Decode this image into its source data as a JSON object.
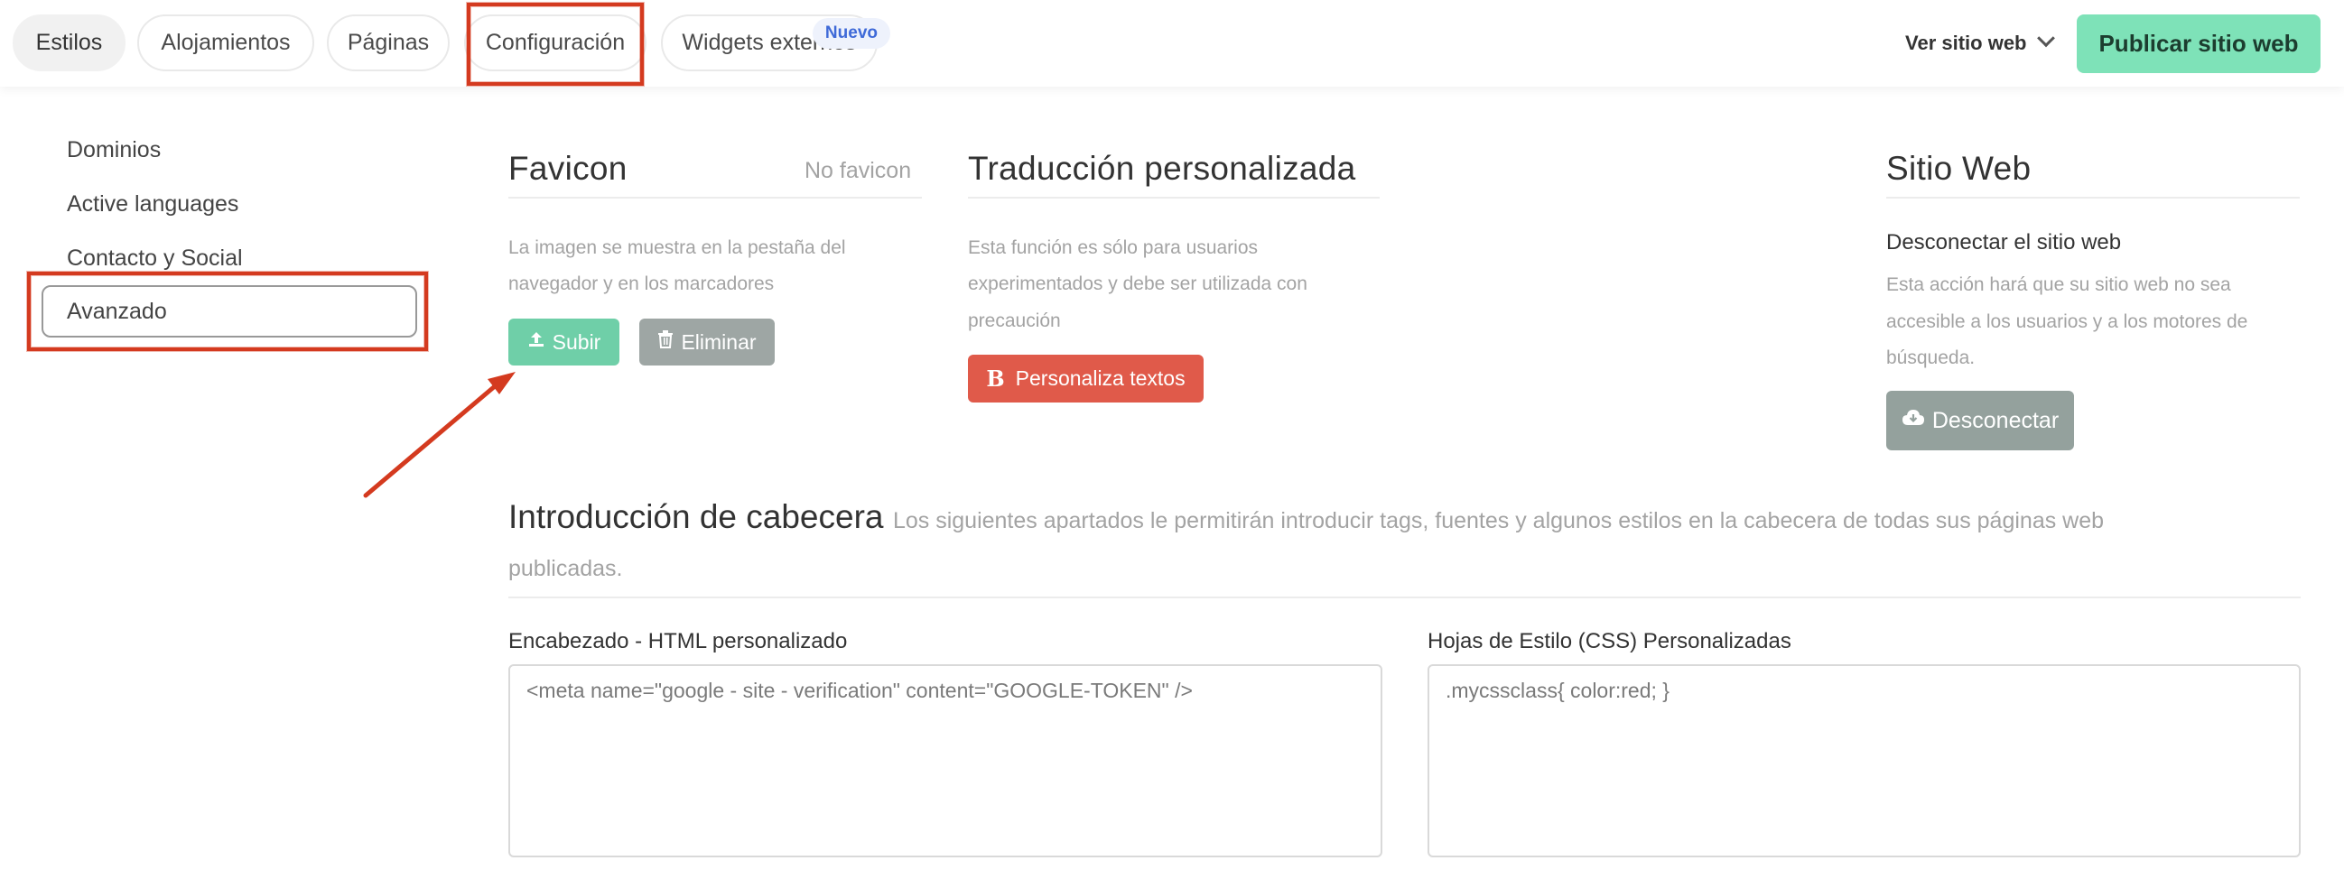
{
  "tabs": [
    {
      "label": "Estilos"
    },
    {
      "label": "Alojamientos"
    },
    {
      "label": "Páginas"
    },
    {
      "label": "Configuración"
    },
    {
      "label": "Widgets externos",
      "badge": "Nuevo"
    }
  ],
  "header": {
    "view_site": "Ver sitio web",
    "publish": "Publicar sitio web"
  },
  "sidebar": {
    "items": [
      {
        "label": "Dominios"
      },
      {
        "label": "Active languages"
      },
      {
        "label": "Contacto y Social"
      },
      {
        "label": "Avanzado"
      }
    ]
  },
  "favicon": {
    "title": "Favicon",
    "status": "No favicon",
    "description_line1": "La imagen se muestra en la pestaña del",
    "description_line2": "navegador y en los marcadores",
    "upload_label": "Subir",
    "delete_label": "Eliminar"
  },
  "translation": {
    "title": "Traducción personalizada",
    "description_line1": "Esta función es sólo para usuarios",
    "description_line2": "experimentados y debe ser utilizada con",
    "description_line3": "precaución",
    "button_label": "Personaliza textos",
    "button_icon": "B"
  },
  "website": {
    "title": "Sitio Web",
    "subtitle": "Desconectar el sitio web",
    "description_line1": "Esta acción hará que su sitio web no sea",
    "description_line2": "accesible a los usuarios y a los motores de",
    "description_line3": "búsqueda.",
    "button_label": "Desconectar"
  },
  "header_intro": {
    "title": "Introducción de cabecera",
    "description_part1": "Los siguientes apartados le permitirán introducir tags, fuentes y algunos estilos en la cabecera de todas sus páginas web",
    "description_part2": "publicadas."
  },
  "custom_html": {
    "label": "Encabezado - HTML personalizado",
    "placeholder": "<meta name=\"google - site - verification\" content=\"GOOGLE-TOKEN\" />"
  },
  "custom_css": {
    "label": "Hojas de Estilo (CSS) Personalizadas",
    "placeholder": ".mycssclass{ color:red; }"
  },
  "colors": {
    "accent_green": "#7ee2b8",
    "upload_green": "#6fcfa8",
    "delete_gray": "#9ea6a4",
    "translation_red": "#e05a4a",
    "disconnect_gray": "#94a19d",
    "annotation_red": "#d43a1f"
  }
}
